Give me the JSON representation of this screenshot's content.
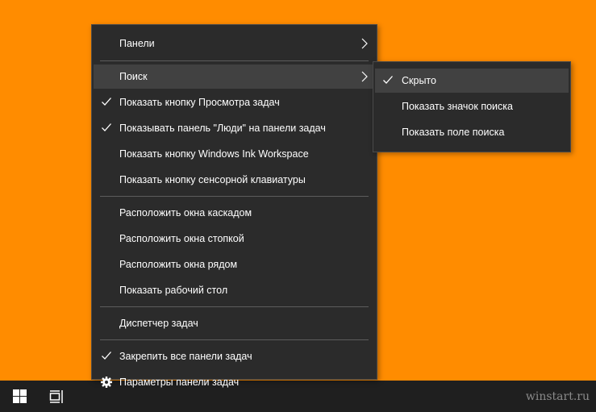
{
  "context_menu": {
    "panels": "Панели",
    "search": "Поиск",
    "show_task_view": "Показать кнопку Просмотра задач",
    "show_people": "Показывать панель \"Люди\" на панели задач",
    "show_ink": "Показать кнопку Windows Ink Workspace",
    "show_keyboard": "Показать кнопку сенсорной клавиатуры",
    "cascade": "Расположить окна каскадом",
    "stack": "Расположить окна стопкой",
    "side_by_side": "Расположить окна рядом",
    "show_desktop": "Показать рабочий стол",
    "task_manager": "Диспетчер задач",
    "lock_taskbars": "Закрепить все панели задач",
    "taskbar_settings": "Параметры панели задач"
  },
  "search_submenu": {
    "hidden": "Скрыто",
    "show_icon": "Показать значок поиска",
    "show_box": "Показать поле поиска"
  },
  "watermark": "winstart.ru",
  "colors": {
    "desktop": "#ff8c00",
    "menu_bg": "#2b2b2b",
    "highlight": "#414141",
    "taskbar": "#1f1f1f"
  },
  "icons": {
    "start": "windows-logo-icon",
    "task_view": "task-view-icon",
    "check": "checkmark-icon",
    "arrow": "chevron-right-icon",
    "settings": "gear-icon"
  }
}
